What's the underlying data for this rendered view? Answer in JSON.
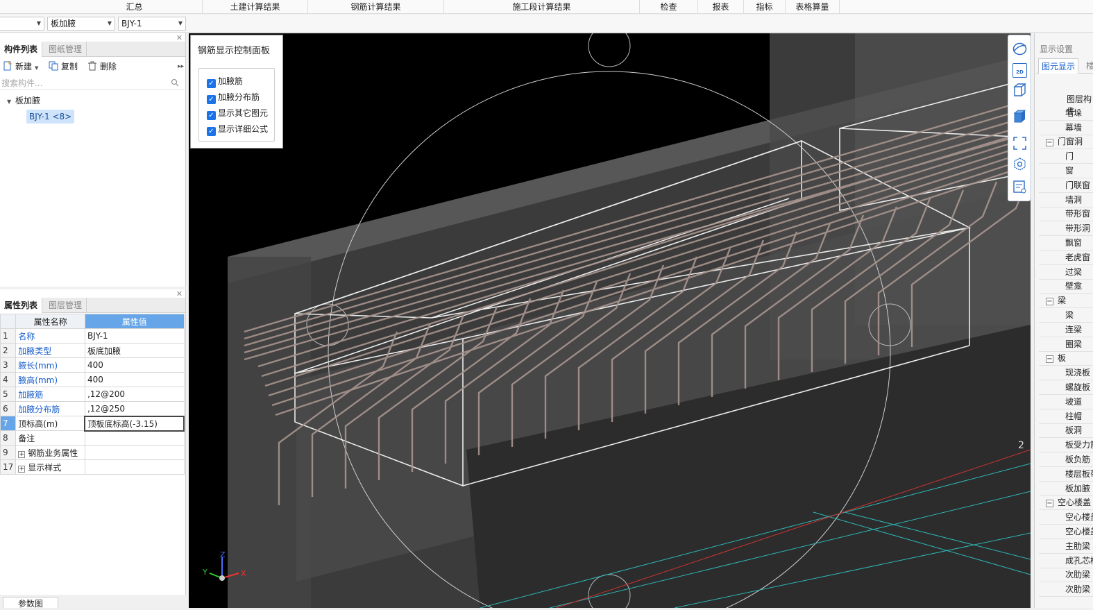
{
  "menu": [
    "汇总",
    "土建计算结果",
    "钢筋计算结果",
    "施工段计算结果",
    "检查",
    "报表",
    "指标",
    "表格算量"
  ],
  "selectors": {
    "first": "",
    "second": "板加腋",
    "third": "BJY-1"
  },
  "component_panel": {
    "tabs": [
      "构件列表",
      "图纸管理"
    ],
    "tools": {
      "new": "新建",
      "copy": "复制",
      "delete": "删除"
    },
    "search_placeholder": "搜索构件...",
    "tree": {
      "group": "板加腋",
      "item": "BJY-1 <8>"
    }
  },
  "property_panel": {
    "tabs": [
      "属性列表",
      "图层管理"
    ],
    "headers": [
      "属性名称",
      "属性值"
    ],
    "rows": [
      {
        "num": "1",
        "name": "名称",
        "value": "BJY-1"
      },
      {
        "num": "2",
        "name": "加腋类型",
        "value": "板底加腋"
      },
      {
        "num": "3",
        "name": "腋长(mm)",
        "value": "400"
      },
      {
        "num": "4",
        "name": "腋高(mm)",
        "value": "400"
      },
      {
        "num": "5",
        "name": "加腋筋",
        "value": "‚12@200"
      },
      {
        "num": "6",
        "name": "加腋分布筋",
        "value": "‚12@250"
      },
      {
        "num": "7",
        "name": "顶标高(m)",
        "value": "顶板底标高(-3.15)"
      },
      {
        "num": "8",
        "name": "备注",
        "value": ""
      },
      {
        "num": "9",
        "name": "钢筋业务属性",
        "value": ""
      },
      {
        "num": "17",
        "name": "显示样式",
        "value": ""
      }
    ]
  },
  "bottom_tab": "参数图",
  "control_panel": {
    "title": "钢筋显示控制面板",
    "options": [
      "加腋筋",
      "加腋分布筋",
      "显示其它图元",
      "显示详细公式"
    ]
  },
  "viewport": {
    "axis_labels": {
      "x": "X",
      "y": "Y",
      "z": "Z"
    },
    "marker": "2"
  },
  "right_toolbar": {
    "icons": [
      "orbit-icon",
      "2d-view-icon",
      "3d-box-icon",
      "solid-view-icon",
      "fit-screen-icon",
      "settings-cube-icon",
      "layer-list-icon"
    ],
    "view_2d": "2D"
  },
  "display_settings": {
    "title": "显示设置",
    "tabs": [
      "图元显示",
      "楼"
    ],
    "header": "图层构件",
    "items": [
      {
        "label": "墙垛",
        "level": 1
      },
      {
        "label": "幕墙",
        "level": 1
      },
      {
        "label": "门窗洞",
        "level": 0,
        "toggle": "−"
      },
      {
        "label": "门",
        "level": 1
      },
      {
        "label": "窗",
        "level": 1
      },
      {
        "label": "门联窗",
        "level": 1
      },
      {
        "label": "墙洞",
        "level": 1
      },
      {
        "label": "带形窗",
        "level": 1
      },
      {
        "label": "带形洞",
        "level": 1
      },
      {
        "label": "飘窗",
        "level": 1
      },
      {
        "label": "老虎窗",
        "level": 1
      },
      {
        "label": "过梁",
        "level": 1
      },
      {
        "label": "壁龛",
        "level": 1
      },
      {
        "label": "梁",
        "level": 0,
        "toggle": "−"
      },
      {
        "label": "梁",
        "level": 1
      },
      {
        "label": "连梁",
        "level": 1
      },
      {
        "label": "圈梁",
        "level": 1
      },
      {
        "label": "板",
        "level": 0,
        "toggle": "−"
      },
      {
        "label": "现浇板",
        "level": 1
      },
      {
        "label": "螺旋板",
        "level": 1
      },
      {
        "label": "坡道",
        "level": 1
      },
      {
        "label": "柱帽",
        "level": 1
      },
      {
        "label": "板洞",
        "level": 1
      },
      {
        "label": "板受力筋",
        "level": 1
      },
      {
        "label": "板负筋",
        "level": 1
      },
      {
        "label": "楼层板带",
        "level": 1
      },
      {
        "label": "板加腋",
        "level": 1
      },
      {
        "label": "空心楼盖",
        "level": 0,
        "toggle": "−"
      },
      {
        "label": "空心楼盖板",
        "level": 1
      },
      {
        "label": "空心楼盖柱帽",
        "level": 1
      },
      {
        "label": "主肋梁",
        "level": 1
      },
      {
        "label": "成孔芯模",
        "level": 1
      },
      {
        "label": "次肋梁",
        "level": 1
      },
      {
        "label": "次肋梁",
        "level": 1
      }
    ]
  }
}
